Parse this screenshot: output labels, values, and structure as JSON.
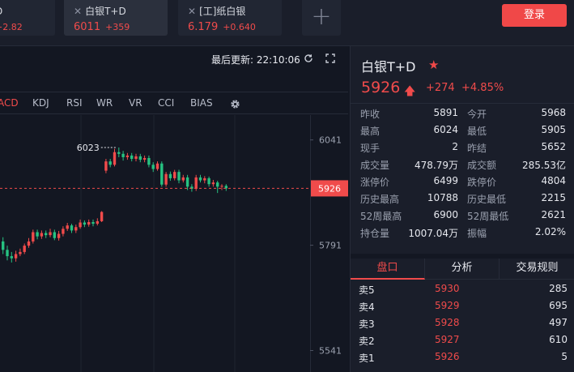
{
  "tabs": [
    {
      "name": "D",
      "price": "",
      "change": "+2.82"
    },
    {
      "name": "白银T+D",
      "price": "6011",
      "change": "+359"
    },
    {
      "name": "[工]纸白银",
      "price": "6.179",
      "change": "+0.640"
    }
  ],
  "add_tab": "+",
  "login_label": "登录",
  "chart_header": {
    "last_update_label": "最后更新:",
    "last_update_time": "22:10:06"
  },
  "indicators": [
    "ACD",
    "KDJ",
    "RSI",
    "WR",
    "VR",
    "CCI",
    "BIAS"
  ],
  "colors": {
    "up": "#f04b4b",
    "down": "#26c281",
    "bg": "#131722",
    "panel": "#1a1e2a",
    "accent": "#f04848"
  },
  "chart_data": {
    "type": "candlestick",
    "y_ticks": [
      6041,
      5791,
      5541
    ],
    "current_price": 5926,
    "high_marker": 6023,
    "ylim": [
      5490,
      6100
    ],
    "candles": [
      {
        "o": 5800,
        "c": 5780,
        "h": 5810,
        "l": 5770
      },
      {
        "o": 5780,
        "c": 5765,
        "h": 5790,
        "l": 5755
      },
      {
        "o": 5765,
        "c": 5760,
        "h": 5775,
        "l": 5750
      },
      {
        "o": 5760,
        "c": 5770,
        "h": 5778,
        "l": 5752
      },
      {
        "o": 5770,
        "c": 5775,
        "h": 5783,
        "l": 5765
      },
      {
        "o": 5775,
        "c": 5790,
        "h": 5795,
        "l": 5770
      },
      {
        "o": 5790,
        "c": 5800,
        "h": 5808,
        "l": 5785
      },
      {
        "o": 5800,
        "c": 5822,
        "h": 5828,
        "l": 5795
      },
      {
        "o": 5822,
        "c": 5812,
        "h": 5828,
        "l": 5805
      },
      {
        "o": 5812,
        "c": 5820,
        "h": 5826,
        "l": 5806
      },
      {
        "o": 5820,
        "c": 5815,
        "h": 5826,
        "l": 5808
      },
      {
        "o": 5815,
        "c": 5822,
        "h": 5830,
        "l": 5810
      },
      {
        "o": 5822,
        "c": 5808,
        "h": 5828,
        "l": 5803
      },
      {
        "o": 5808,
        "c": 5818,
        "h": 5825,
        "l": 5802
      },
      {
        "o": 5818,
        "c": 5830,
        "h": 5836,
        "l": 5812
      },
      {
        "o": 5830,
        "c": 5838,
        "h": 5844,
        "l": 5825
      },
      {
        "o": 5838,
        "c": 5826,
        "h": 5842,
        "l": 5820
      },
      {
        "o": 5826,
        "c": 5834,
        "h": 5840,
        "l": 5820
      },
      {
        "o": 5834,
        "c": 5845,
        "h": 5852,
        "l": 5830
      },
      {
        "o": 5845,
        "c": 5840,
        "h": 5850,
        "l": 5834
      },
      {
        "o": 5840,
        "c": 5846,
        "h": 5852,
        "l": 5835
      },
      {
        "o": 5846,
        "c": 5842,
        "h": 5852,
        "l": 5836
      },
      {
        "o": 5842,
        "c": 5848,
        "h": 5855,
        "l": 5838
      },
      {
        "o": 5848,
        "c": 5870,
        "h": 5872,
        "l": 5846
      },
      {
        "o": 5968,
        "c": 5990,
        "h": 5996,
        "l": 5962
      },
      {
        "o": 5990,
        "c": 5982,
        "h": 5996,
        "l": 5976
      },
      {
        "o": 5982,
        "c": 6012,
        "h": 6020,
        "l": 5978
      },
      {
        "o": 6012,
        "c": 6008,
        "h": 6023,
        "l": 6000
      },
      {
        "o": 6008,
        "c": 6000,
        "h": 6015,
        "l": 5992
      },
      {
        "o": 6000,
        "c": 6004,
        "h": 6010,
        "l": 5994
      },
      {
        "o": 6004,
        "c": 5996,
        "h": 6010,
        "l": 5990
      },
      {
        "o": 5996,
        "c": 6002,
        "h": 6008,
        "l": 5990
      },
      {
        "o": 6002,
        "c": 5994,
        "h": 6008,
        "l": 5988
      },
      {
        "o": 5994,
        "c": 5998,
        "h": 6004,
        "l": 5988
      },
      {
        "o": 5998,
        "c": 5982,
        "h": 6004,
        "l": 5976
      },
      {
        "o": 5982,
        "c": 5972,
        "h": 5988,
        "l": 5965
      },
      {
        "o": 5972,
        "c": 5985,
        "h": 5990,
        "l": 5968
      },
      {
        "o": 5985,
        "c": 5935,
        "h": 5990,
        "l": 5930
      },
      {
        "o": 5935,
        "c": 5960,
        "h": 5965,
        "l": 5930
      },
      {
        "o": 5960,
        "c": 5950,
        "h": 5966,
        "l": 5944
      },
      {
        "o": 5950,
        "c": 5965,
        "h": 5970,
        "l": 5945
      },
      {
        "o": 5965,
        "c": 5945,
        "h": 5970,
        "l": 5938
      },
      {
        "o": 5945,
        "c": 5952,
        "h": 5958,
        "l": 5940
      },
      {
        "o": 5952,
        "c": 5930,
        "h": 5958,
        "l": 5922
      },
      {
        "o": 5930,
        "c": 5925,
        "h": 5936,
        "l": 5918
      },
      {
        "o": 5925,
        "c": 5952,
        "h": 5958,
        "l": 5920
      },
      {
        "o": 5952,
        "c": 5945,
        "h": 5958,
        "l": 5940
      },
      {
        "o": 5945,
        "c": 5950,
        "h": 5955,
        "l": 5938
      },
      {
        "o": 5950,
        "c": 5936,
        "h": 5954,
        "l": 5930
      },
      {
        "o": 5936,
        "c": 5940,
        "h": 5946,
        "l": 5930
      },
      {
        "o": 5940,
        "c": 5930,
        "h": 5944,
        "l": 5915
      },
      {
        "o": 5930,
        "c": 5932,
        "h": 5936,
        "l": 5922
      },
      {
        "o": 5932,
        "c": 5926,
        "h": 5936,
        "l": 5920
      }
    ]
  },
  "quote": {
    "title": "白银T+D",
    "price": "5926",
    "change": "+274",
    "percent": "+4.85%",
    "stats": [
      {
        "l1": "昨收",
        "v1": "5891",
        "l2": "今开",
        "v2": "5968"
      },
      {
        "l1": "最高",
        "v1": "6024",
        "l2": "最低",
        "v2": "5905"
      },
      {
        "l1": "现手",
        "v1": "2",
        "l2": "昨结",
        "v2": "5652"
      },
      {
        "l1": "成交量",
        "v1": "478.79万",
        "l2": "成交额",
        "v2": "285.53亿"
      },
      {
        "l1": "涨停价",
        "v1": "6499",
        "l2": "跌停价",
        "v2": "4804"
      },
      {
        "l1": "历史最高",
        "v1": "10788",
        "l2": "历史最低",
        "v2": "2215"
      },
      {
        "l1": "52周最高",
        "v1": "6900",
        "l2": "52周最低",
        "v2": "2621"
      },
      {
        "l1": "持仓量",
        "v1": "1007.04万",
        "l2": "振幅",
        "v2": "2.02%"
      }
    ]
  },
  "bottom_tabs": [
    "盘口",
    "分析",
    "交易规则"
  ],
  "order_book": [
    {
      "label": "卖5",
      "price": "5930",
      "volume": "285"
    },
    {
      "label": "卖4",
      "price": "5929",
      "volume": "695"
    },
    {
      "label": "卖3",
      "price": "5928",
      "volume": "497"
    },
    {
      "label": "卖2",
      "price": "5927",
      "volume": "610"
    },
    {
      "label": "卖1",
      "price": "5926",
      "volume": "5"
    }
  ]
}
